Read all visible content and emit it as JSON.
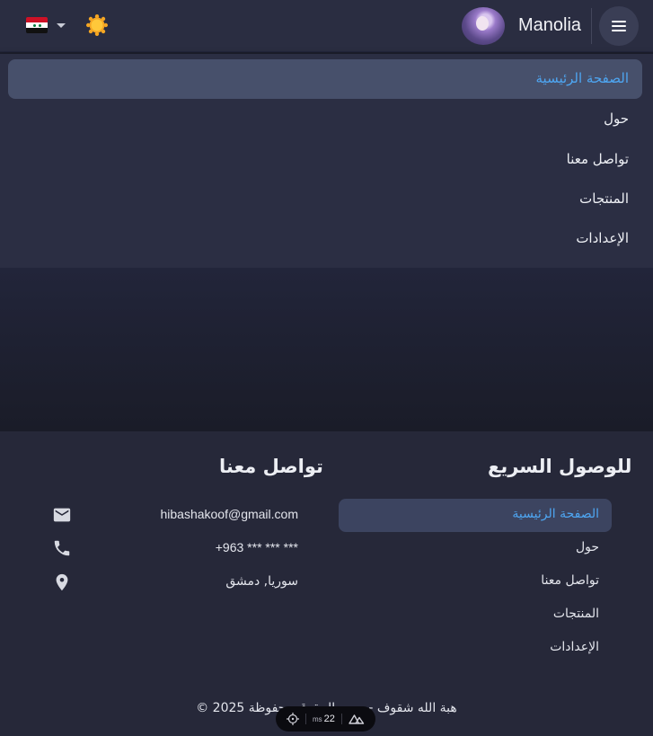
{
  "header": {
    "username": "Manolia",
    "language_flag": "syria-flag-icon",
    "theme_icon": "sun-icon",
    "menu_icon": "hamburger-menu-icon"
  },
  "nav": {
    "items": [
      {
        "label": "الصفحة الرئيسية",
        "active": true
      },
      {
        "label": "حول",
        "active": false
      },
      {
        "label": "تواصل معنا",
        "active": false
      },
      {
        "label": "المنتجات",
        "active": false
      },
      {
        "label": "الإعدادات",
        "active": false
      }
    ]
  },
  "footer": {
    "quick_links_title": "للوصول السريع",
    "quick_links": [
      {
        "label": "الصفحة الرئيسية",
        "active": true
      },
      {
        "label": "حول",
        "active": false
      },
      {
        "label": "تواصل معنا",
        "active": false
      },
      {
        "label": "المنتجات",
        "active": false
      },
      {
        "label": "الإعدادات",
        "active": false
      }
    ],
    "contact_title": "تواصل معنا",
    "contact": {
      "email": "hibashakoof@gmail.com",
      "phone": "+963 *** *** ***",
      "location": "سوريا, دمشق"
    },
    "copyright": "هبة الله شقوف - جميع الحقوق محفوظة 2025 ©"
  },
  "devbar": {
    "ms_value": "22",
    "ms_unit": "ms"
  },
  "colors": {
    "accent": "#4ea6f2",
    "appbar": "#2a2d41",
    "active_bg": "#47506b"
  }
}
